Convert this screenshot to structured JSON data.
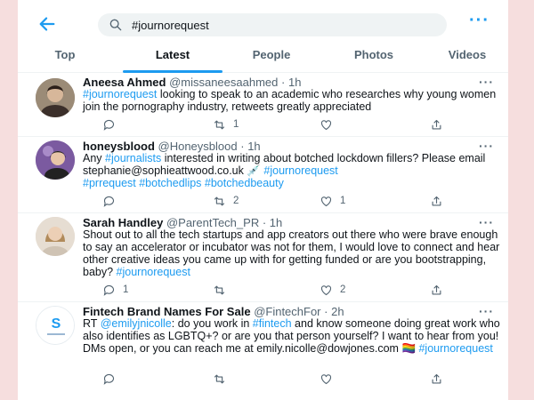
{
  "search": {
    "query": "#journorequest"
  },
  "tabs": [
    "Top",
    "Latest",
    "People",
    "Photos",
    "Videos"
  ],
  "colors": {
    "accent": "#1d9bf0",
    "muted": "#536471",
    "text": "#0f1419",
    "page_bg": "#f6dede"
  },
  "tweets": [
    {
      "name": "Aneesa Ahmed",
      "handle": "@missaneesaahmed",
      "dot": "·",
      "time": "1h",
      "tag1": "#journorequest",
      "text1": " looking to speak to an academic who researches why young women join the pornography industry, retweets greatly appreciated",
      "replies": "",
      "retweets": "1",
      "likes": ""
    },
    {
      "name": "honeysblood",
      "handle": "@Honeysblood",
      "dot": "·",
      "time": "1h",
      "pre": "Any ",
      "tag1": "#journalists",
      "text1": " interested in writing about botched lockdown fillers? Please email stephanie@sophieattwood.co.uk 💉 ",
      "tag2": "#journorequest",
      "tag3": "#prrequest #botchedlips #botchedbeauty",
      "replies": "",
      "retweets": "2",
      "likes": "1"
    },
    {
      "name": "Sarah Handley",
      "handle": "@ParentTech_PR",
      "dot": "·",
      "time": "1h",
      "text1": "Shout out to all the tech startups and app creators out there who were brave enough to say an accelerator or incubator was not for them, I would love to connect and hear other creative ideas you came up with for getting funded or are you bootstrapping, baby? ",
      "tag1": "#journorequest",
      "replies": "1",
      "retweets": "",
      "likes": "2"
    },
    {
      "name": "Fintech Brand Names For Sale",
      "handle": "@FintechFor",
      "dot": "·",
      "time": "2h",
      "pre": "RT ",
      "tag1": "@emilyjnicolle",
      "text1": ": do you work in ",
      "tag2": "#fintech",
      "text2": " and know someone doing great work who also identifies as LGBTQ+? or are you that person yourself? I want to hear from you! DMs open, or you can reach me at emily.nicolle@dowjones.com 🏳️‍🌈 ",
      "tag3": "#journorequest",
      "replies": "",
      "retweets": "",
      "likes": ""
    }
  ]
}
